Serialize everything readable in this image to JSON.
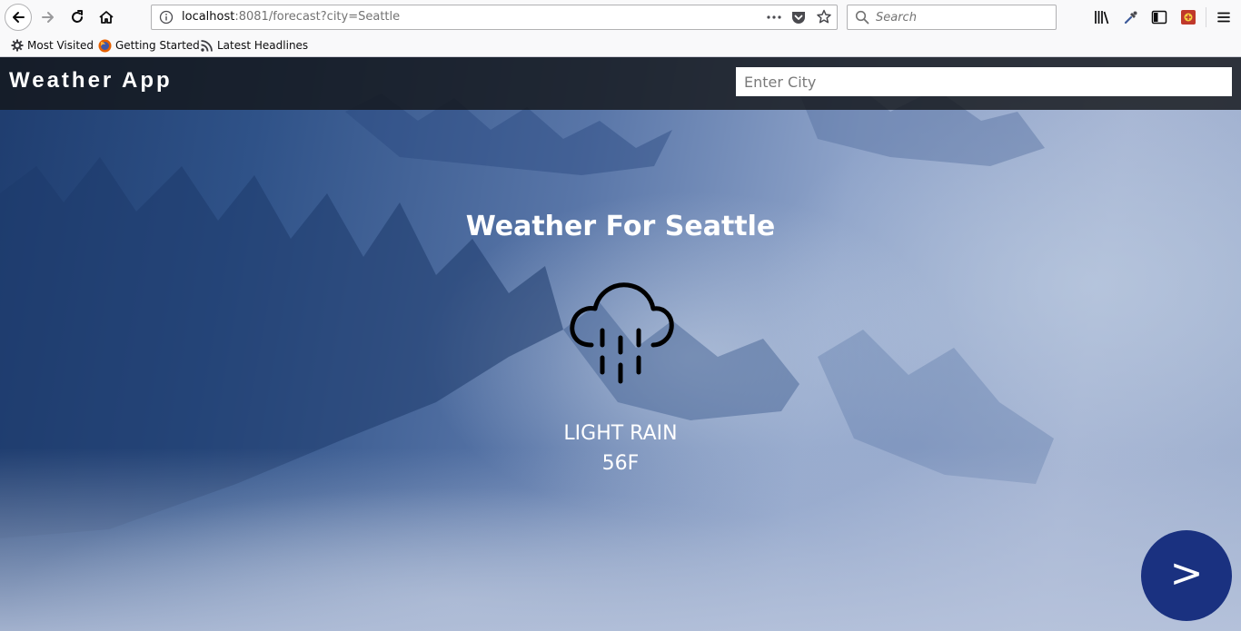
{
  "browser": {
    "url_host": "localhost",
    "url_rest": ":8081/forecast?city=Seattle",
    "search_placeholder": "Search",
    "bookmarks": [
      {
        "label": "Most Visited",
        "icon": "gear-icon"
      },
      {
        "label": "Getting Started",
        "icon": "firefox-icon"
      },
      {
        "label": "Latest Headlines",
        "icon": "rss-icon"
      }
    ]
  },
  "app": {
    "title": "Weather App",
    "city_input_placeholder": "Enter City",
    "city_input_value": ""
  },
  "weather": {
    "heading": "Weather For Seattle",
    "icon": "rain-cloud-icon",
    "description": "LIGHT RAIN",
    "temperature": "56F"
  },
  "next_button": {
    "label": ">",
    "color": "#1a3180"
  }
}
